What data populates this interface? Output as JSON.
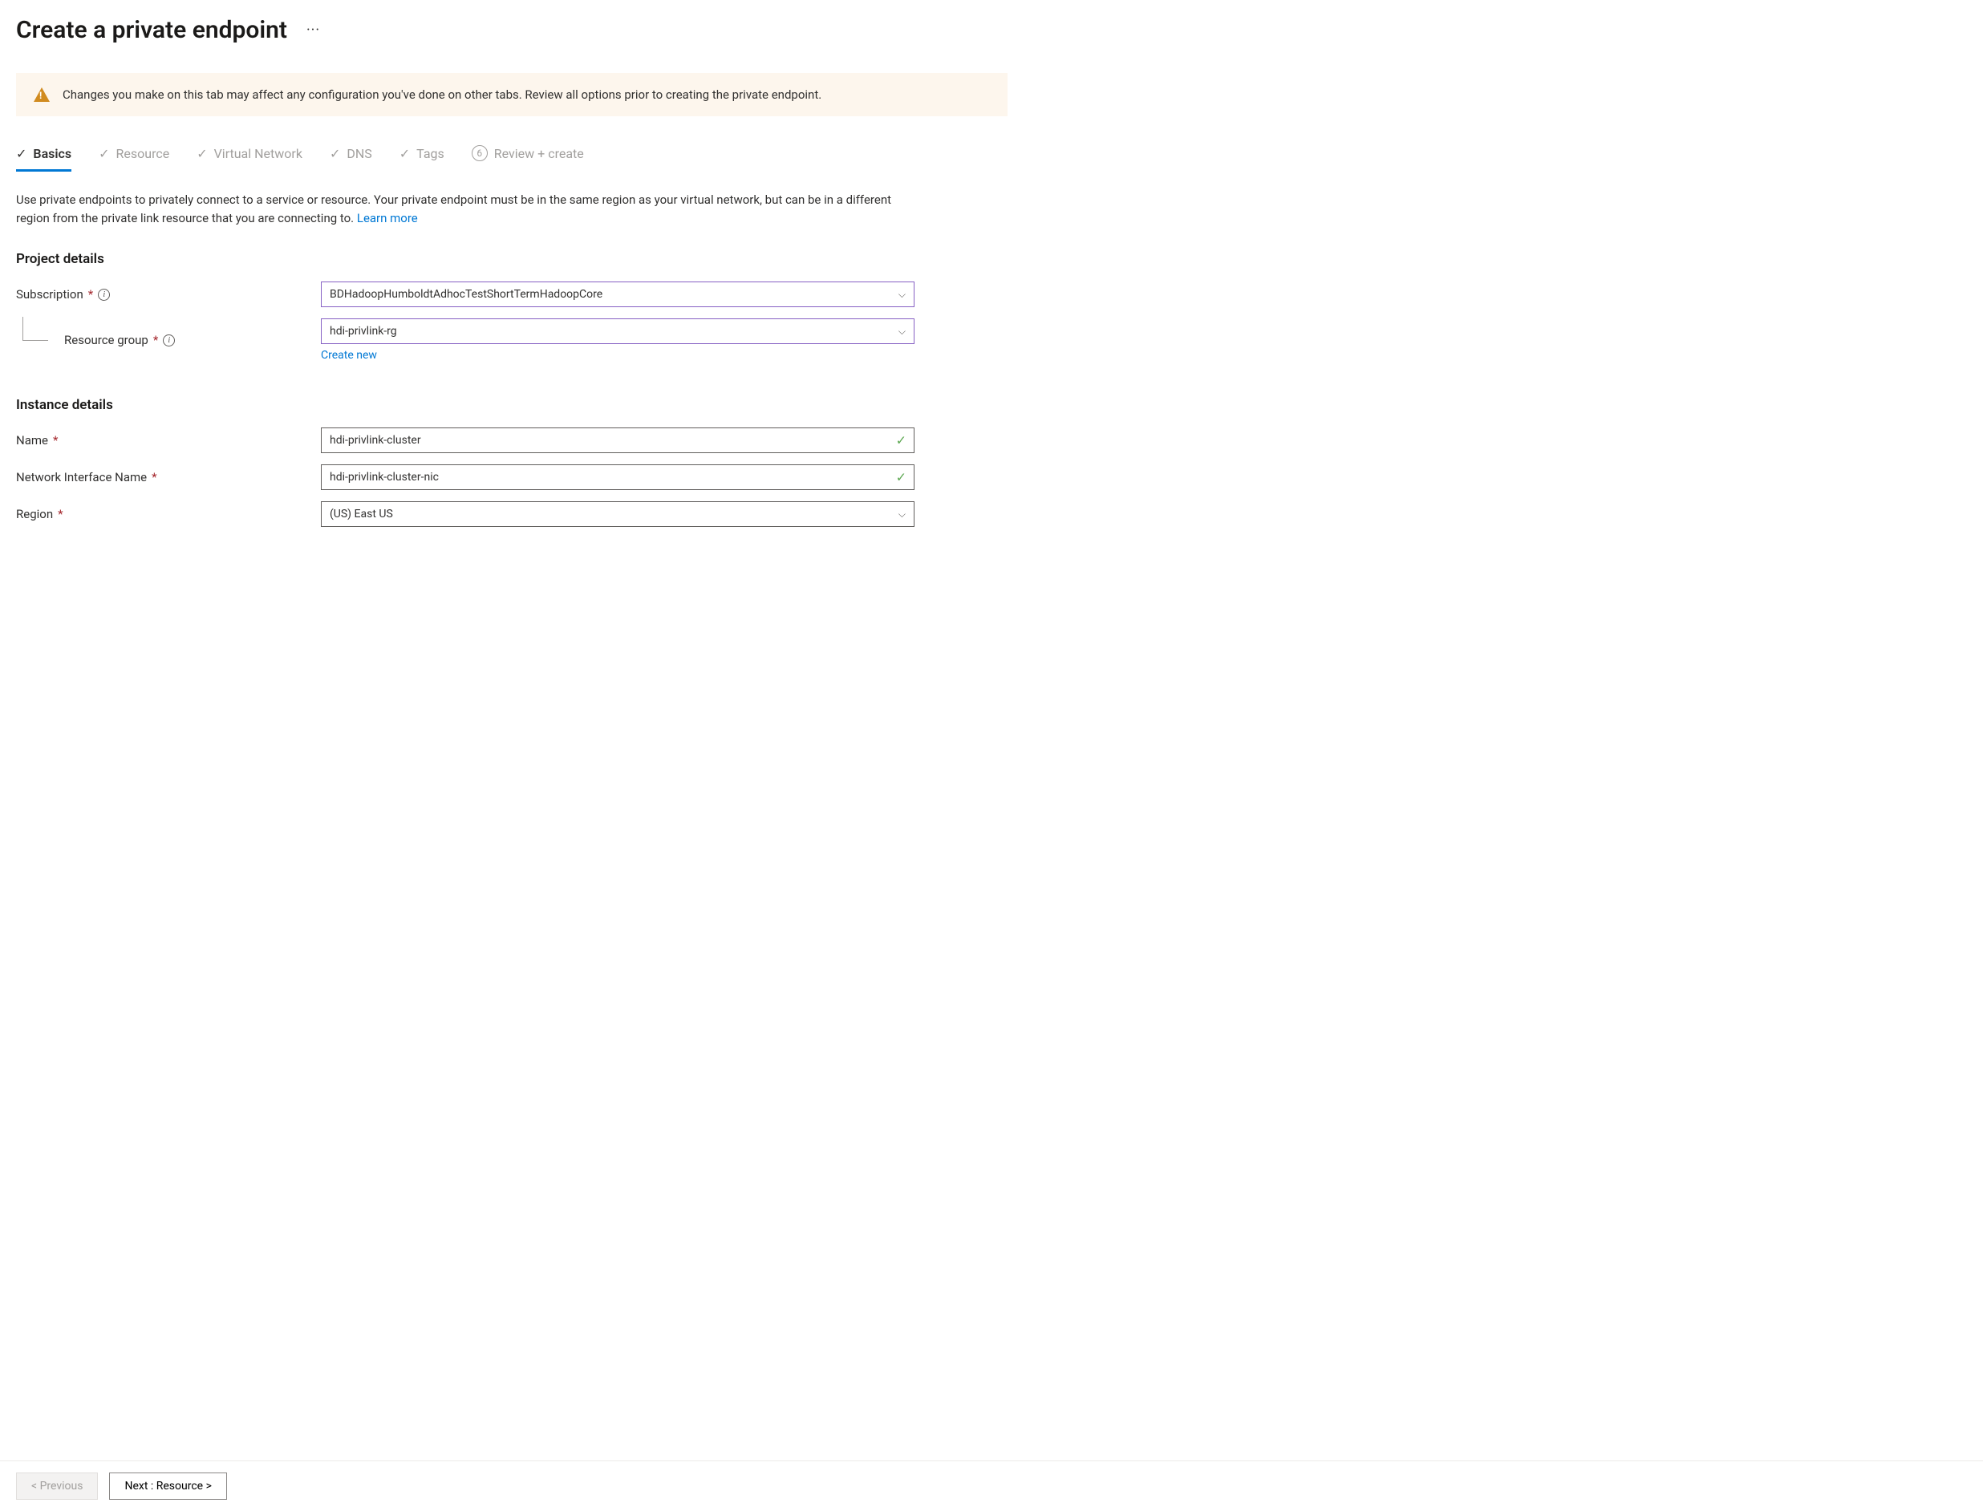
{
  "header": {
    "title": "Create a private endpoint"
  },
  "warning": {
    "text": "Changes you make on this tab may affect any configuration you've done on other tabs. Review all options prior to creating the private endpoint."
  },
  "tabs": {
    "basics": "Basics",
    "resource": "Resource",
    "virtual_network": "Virtual Network",
    "dns": "DNS",
    "tags": "Tags",
    "review_num": "6",
    "review": "Review + create"
  },
  "description": {
    "text": "Use private endpoints to privately connect to a service or resource. Your private endpoint must be in the same region as your virtual network, but can be in a different region from the private link resource that you are connecting to.  ",
    "learn_more": "Learn more"
  },
  "sections": {
    "project_title": "Project details",
    "instance_title": "Instance details"
  },
  "form": {
    "subscription": {
      "label": "Subscription",
      "value": "BDHadoopHumboldtAdhocTestShortTermHadoopCore"
    },
    "resource_group": {
      "label": "Resource group",
      "value": "hdi-privlink-rg",
      "create_new": "Create new"
    },
    "name": {
      "label": "Name",
      "value": "hdi-privlink-cluster"
    },
    "nic_name": {
      "label": "Network Interface Name",
      "value": "hdi-privlink-cluster-nic"
    },
    "region": {
      "label": "Region",
      "value": "(US) East US"
    }
  },
  "footer": {
    "previous": "< Previous",
    "next": "Next : Resource >"
  }
}
